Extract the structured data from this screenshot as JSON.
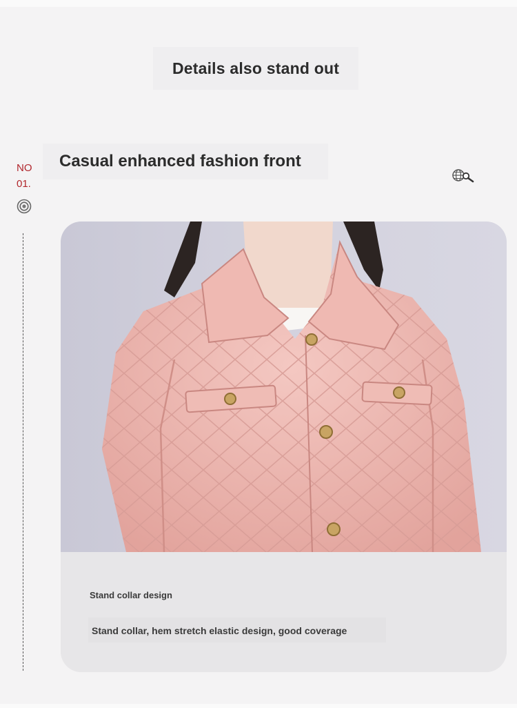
{
  "header": {
    "title": "Details also stand out"
  },
  "section": {
    "number_label": "NO",
    "number_value": "01.",
    "title": "Casual enhanced fashion front"
  },
  "card": {
    "caption_title": "Stand collar design",
    "caption_description": "Stand collar, hem stretch elastic design, good coverage"
  },
  "icons": {
    "target": "target-icon",
    "globe_search": "globe-search-icon"
  },
  "colors": {
    "accent": "#b1262c",
    "jacket": "#e9b3ad",
    "background": "#f4f3f4"
  }
}
